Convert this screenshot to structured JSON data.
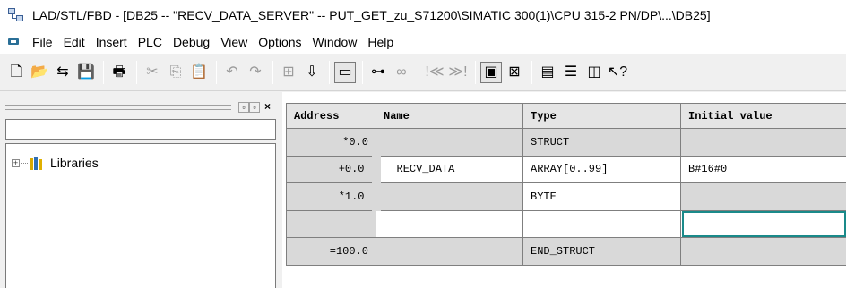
{
  "window": {
    "title": "LAD/STL/FBD  - [DB25 -- \"RECV_DATA_SERVER\" -- PUT_GET_zu_S71200\\SIMATIC 300(1)\\CPU 315-2 PN/DP\\...\\DB25]"
  },
  "menu": {
    "items": [
      "File",
      "Edit",
      "Insert",
      "PLC",
      "Debug",
      "View",
      "Options",
      "Window",
      "Help"
    ]
  },
  "toolbar": {
    "icons": [
      {
        "name": "new-icon",
        "glyph": "🗋"
      },
      {
        "name": "open-icon",
        "glyph": "📂"
      },
      {
        "name": "accessible-nodes-icon",
        "glyph": "⇆"
      },
      {
        "name": "save-icon",
        "glyph": "💾"
      },
      {
        "name": "print-icon",
        "glyph": "🖶"
      },
      {
        "name": "cut-icon",
        "glyph": "✂"
      },
      {
        "name": "copy-icon",
        "glyph": "⎘"
      },
      {
        "name": "paste-icon",
        "glyph": "📋"
      },
      {
        "name": "undo-icon",
        "glyph": "↶"
      },
      {
        "name": "redo-icon",
        "glyph": "↷"
      },
      {
        "name": "fbd-icon",
        "glyph": "⊞"
      },
      {
        "name": "download-icon",
        "glyph": "⇩"
      },
      {
        "name": "overview-icon",
        "glyph": "▭"
      },
      {
        "name": "network-icon",
        "glyph": "⊶"
      },
      {
        "name": "glasses-icon",
        "glyph": "∞"
      },
      {
        "name": "prev-network-icon",
        "glyph": "!≪"
      },
      {
        "name": "next-network-icon",
        "glyph": "≫!"
      },
      {
        "name": "window-icon",
        "glyph": "▣"
      },
      {
        "name": "monitor-icon",
        "glyph": "⊠"
      },
      {
        "name": "declaration-icon",
        "glyph": "▤"
      },
      {
        "name": "details-icon",
        "glyph": "☰"
      },
      {
        "name": "columns-icon",
        "glyph": "◫"
      },
      {
        "name": "help-icon",
        "glyph": "↖?"
      }
    ]
  },
  "left_panel": {
    "tree": [
      {
        "expander": "+",
        "label": "Libraries"
      }
    ]
  },
  "table": {
    "columns": [
      "Address",
      "Name",
      "Type",
      "Initial value"
    ],
    "rows": [
      {
        "address": "*0.0",
        "name": "",
        "type": "STRUCT",
        "initial": ""
      },
      {
        "address": "+0.0",
        "name": "RECV_DATA",
        "type": "ARRAY[0..99]",
        "initial": "B#16#0"
      },
      {
        "address": "*1.0",
        "name": "",
        "type": "BYTE",
        "initial": ""
      },
      {
        "address": "",
        "name": "",
        "type": "",
        "initial": ""
      },
      {
        "address": "=100.0",
        "name": "",
        "type": "END_STRUCT",
        "initial": ""
      }
    ]
  }
}
